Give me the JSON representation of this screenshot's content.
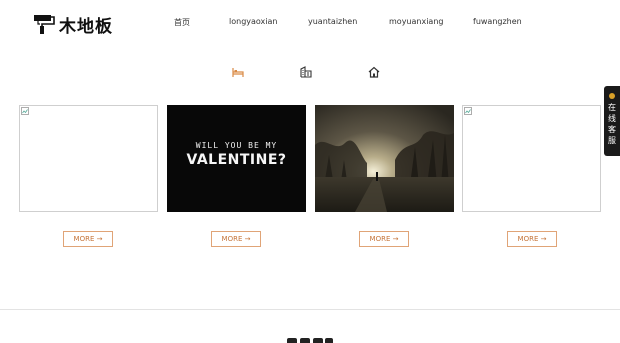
{
  "header": {
    "logo_text": "木地板",
    "nav": [
      "首页",
      "longyaoxian",
      "yuantaizhen",
      "moyuanxiang",
      "fuwangzhen"
    ]
  },
  "categories": [
    {
      "icon": "bed-icon",
      "active": true
    },
    {
      "icon": "buildings-icon",
      "active": false
    },
    {
      "icon": "house-icon",
      "active": false
    }
  ],
  "cards": [
    {
      "type": "broken-image"
    },
    {
      "type": "valentine",
      "line1": "WILL YOU BE MY",
      "line2": "VALENTINE?"
    },
    {
      "type": "forest-photo"
    },
    {
      "type": "broken-image"
    }
  ],
  "more_label": "MORE →",
  "service": {
    "label": "在线客服"
  },
  "colors": {
    "accent": "#c6763b",
    "accent_border": "#e0a477",
    "service_bg": "#1a1a1a"
  }
}
